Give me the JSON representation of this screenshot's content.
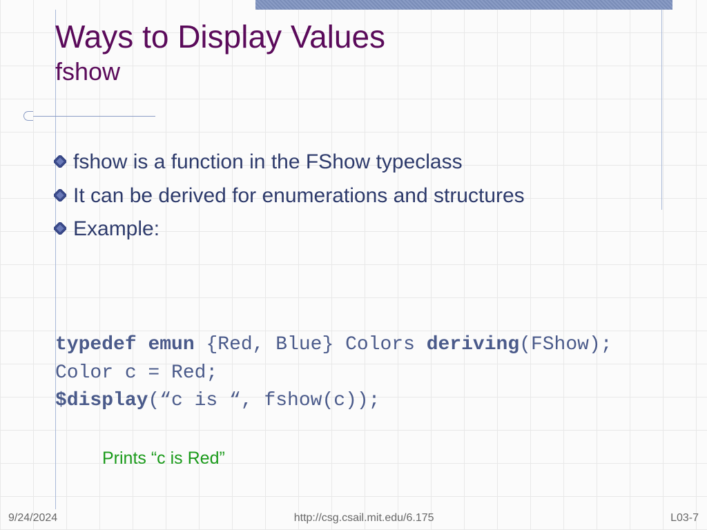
{
  "title": "Ways to Display Values",
  "subtitle": "fshow",
  "bullets": [
    "fshow is a function in the FShow typeclass",
    "It can be derived for enumerations and structures",
    "Example:"
  ],
  "code": {
    "line1_kw1": "typedef",
    "line1_kw2": "emun",
    "line1_mid": " {Red, Blue} Colors ",
    "line1_kw3": "deriving",
    "line1_end": "(FShow);",
    "line2": "Color c = Red;",
    "line3_kw": "$display",
    "line3_rest": "(“c is “, fshow(c));"
  },
  "output": "Prints “c is Red”",
  "footer": {
    "date": "9/24/2024",
    "url": "http://csg.csail.mit.edu/6.175",
    "slide": "L03-7"
  }
}
